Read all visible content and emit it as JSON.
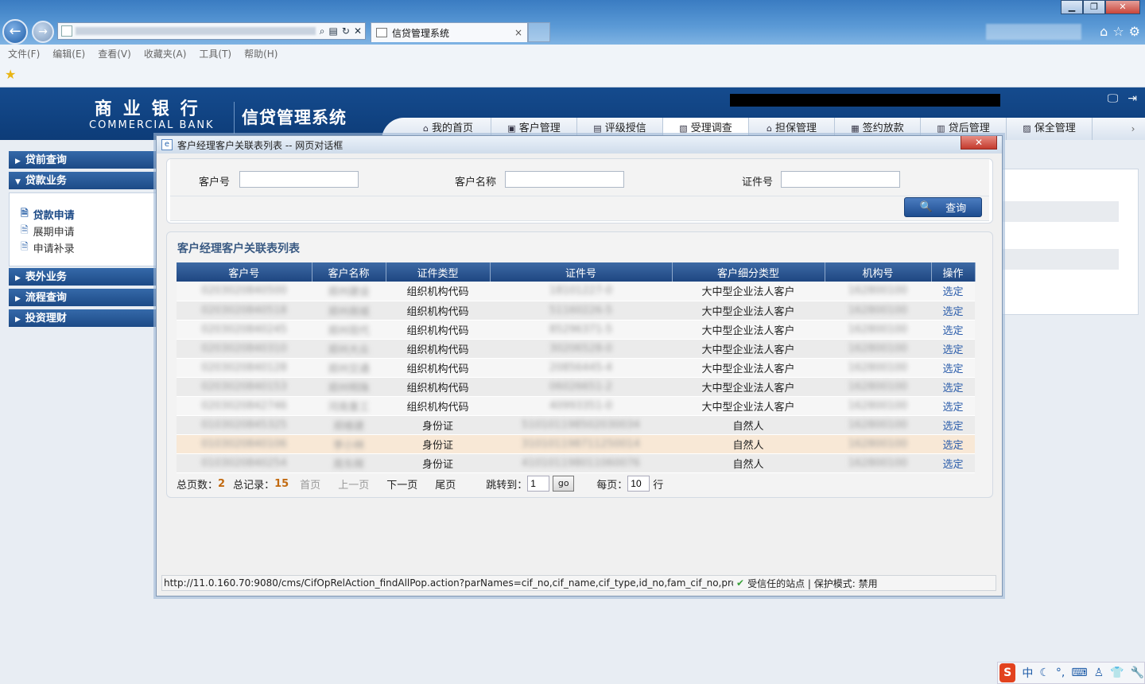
{
  "browser": {
    "tab_title": "信贷管理系统",
    "tab_close": "×",
    "menu": [
      "文件(F)",
      "编辑(E)",
      "查看(V)",
      "收藏夹(A)",
      "工具(T)",
      "帮助(H)"
    ],
    "win_min": "▁",
    "win_max": "❐",
    "win_close": "✕"
  },
  "header": {
    "brand_cn": "商业银行",
    "brand_en": "COMMERCIAL BANK",
    "system_title": "信贷管理系统",
    "nav": [
      {
        "label": "我的首页",
        "icon": "home-icon",
        "glyph": "⌂"
      },
      {
        "label": "客户管理",
        "icon": "customer-icon",
        "glyph": "▣"
      },
      {
        "label": "评级授信",
        "icon": "rating-icon",
        "glyph": "▤"
      },
      {
        "label": "受理调查",
        "icon": "survey-icon",
        "glyph": "▧"
      },
      {
        "label": "担保管理",
        "icon": "guarantee-icon",
        "glyph": "⌂"
      },
      {
        "label": "签约放款",
        "icon": "contract-icon",
        "glyph": "▦"
      },
      {
        "label": "贷后管理",
        "icon": "postloan-icon",
        "glyph": "▥"
      },
      {
        "label": "保全管理",
        "icon": "preserve-icon",
        "glyph": "▨"
      }
    ],
    "active_nav": 3
  },
  "sidebar": {
    "groups": [
      {
        "label": "贷前查询",
        "expanded": false
      },
      {
        "label": "贷款业务",
        "expanded": true,
        "items": [
          "贷款申请",
          "展期申请",
          "申请补录"
        ],
        "active_item": 0
      },
      {
        "label": "表外业务",
        "expanded": false
      },
      {
        "label": "流程查询",
        "expanded": false
      },
      {
        "label": "投资理财",
        "expanded": false
      }
    ]
  },
  "dialog": {
    "title": "客户经理客户关联表列表 -- 网页对话框",
    "close": "✕",
    "search": {
      "cust_no_label": "客户号",
      "cust_no_value": "",
      "cust_name_label": "客户名称",
      "cust_name_value": "",
      "id_no_label": "证件号",
      "id_no_value": "",
      "query_button": "查询"
    },
    "list_title": "客户经理客户关联表列表",
    "columns": [
      "客户号",
      "客户名称",
      "证件类型",
      "证件号",
      "客户细分类型",
      "机构号",
      "操作"
    ],
    "rows": [
      {
        "cust_no": "0203020840500",
        "cust_name": "郑州建设",
        "id_type": "组织机构代码",
        "id_no": "18101227-0",
        "segment": "大中型企业法人客户",
        "org": "162800100",
        "action": "选定"
      },
      {
        "cust_no": "0203020840518",
        "cust_name": "郑州商城",
        "id_type": "组织机构代码",
        "id_no": "51160226-5",
        "segment": "大中型企业法人客户",
        "org": "162800100",
        "action": "选定"
      },
      {
        "cust_no": "0203020840245",
        "cust_name": "郑州现代",
        "id_type": "组织机构代码",
        "id_no": "85296371-5",
        "segment": "大中型企业法人客户",
        "org": "162800100",
        "action": "选定"
      },
      {
        "cust_no": "0203020840310",
        "cust_name": "郑州大众",
        "id_type": "组织机构代码",
        "id_no": "30206528-0",
        "segment": "大中型企业法人客户",
        "org": "162800100",
        "action": "选定"
      },
      {
        "cust_no": "0203020840128",
        "cust_name": "郑州交通",
        "id_type": "组织机构代码",
        "id_no": "20856445-4",
        "segment": "大中型企业法人客户",
        "org": "162800100",
        "action": "选定"
      },
      {
        "cust_no": "0203020840153",
        "cust_name": "郑州明珠",
        "id_type": "组织机构代码",
        "id_no": "06026651-2",
        "segment": "大中型企业法人客户",
        "org": "162800100",
        "action": "选定"
      },
      {
        "cust_no": "0203020842746",
        "cust_name": "河南重工",
        "id_type": "组织机构代码",
        "id_no": "40993351-0",
        "segment": "大中型企业法人客户",
        "org": "162800100",
        "action": "选定"
      },
      {
        "cust_no": "0103020845325",
        "cust_name": "郑维建",
        "id_type": "身份证",
        "id_no": "510101198502030034",
        "segment": "自然人",
        "org": "162800100",
        "action": "选定"
      },
      {
        "cust_no": "0103020840106",
        "cust_name": "李小林",
        "id_type": "身份证",
        "id_no": "310101198711250014",
        "segment": "自然人",
        "org": "162800100",
        "action": "选定"
      },
      {
        "cust_no": "0103020840254",
        "cust_name": "周东辉",
        "id_type": "身份证",
        "id_no": "410101198011060076",
        "segment": "自然人",
        "org": "162800100",
        "action": "选定"
      }
    ],
    "highlight_row": 8,
    "pager": {
      "total_pages_label": "总页数：",
      "total_pages": "2",
      "total_records_label": "总记录：",
      "total_records": "15",
      "first": "首页",
      "prev": "上一页",
      "next": "下一页",
      "last": "尾页",
      "jump_label": "跳转到：",
      "jump_value": "1",
      "go": "go",
      "per_page_label": "每页：",
      "per_page_value": "10",
      "per_page_unit": "行"
    },
    "status": {
      "url": "http://11.0.160.70:9080/cms/CifOpRelAction_findAllPop.action?parNames=cif_no,cif_name,cif_type,id_no,fam_cif_no,proj_size",
      "zone": "受信任的站点 | 保护模式: 禁用"
    }
  },
  "tray": {
    "ime": "S",
    "lang": "中"
  }
}
